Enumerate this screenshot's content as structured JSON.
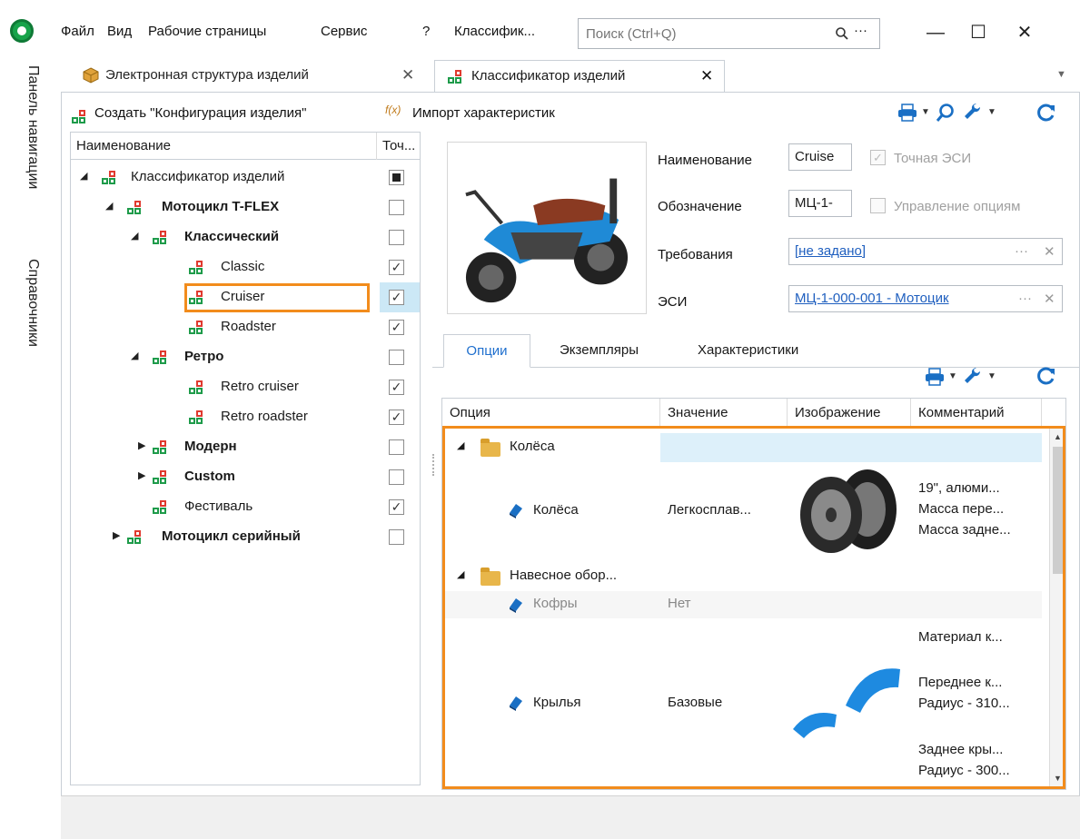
{
  "menu": [
    "Файл",
    "Вид",
    "Рабочие страницы",
    "Сервис",
    "?",
    "Классифик..."
  ],
  "search": {
    "placeholder": "Поиск (Ctrl+Q)"
  },
  "window_buttons": {
    "minimize": "—",
    "maximize": "☐",
    "close": "✕"
  },
  "nav": {
    "panel": "Панель навигации",
    "refs": "Справочники"
  },
  "tabs": [
    {
      "label": "Электронная структура изделий",
      "close": "✕"
    },
    {
      "label": "Классификатор изделий",
      "close": "✕"
    }
  ],
  "toolbar": {
    "create": "Создать \"Конфигурация изделия\"",
    "import": "Импорт характеристик"
  },
  "tree": {
    "headers": [
      "Наименование",
      "Точ..."
    ],
    "rows": [
      {
        "label": "Классификатор изделий",
        "expander": "◢",
        "check": "filled"
      },
      {
        "label": "Мотоцикл T-FLEX",
        "expander": "◢",
        "check": ""
      },
      {
        "label": "Классический",
        "expander": "◢",
        "check": ""
      },
      {
        "label": "Classic",
        "expander": "",
        "check": "✓"
      },
      {
        "label": "Cruiser",
        "expander": "",
        "check": "✓"
      },
      {
        "label": "Roadster",
        "expander": "",
        "check": "✓"
      },
      {
        "label": "Ретро",
        "expander": "◢",
        "check": ""
      },
      {
        "label": "Retro cruiser",
        "expander": "",
        "check": "✓"
      },
      {
        "label": "Retro roadster",
        "expander": "",
        "check": "✓"
      },
      {
        "label": "Модерн",
        "expander": "▶",
        "check": ""
      },
      {
        "label": "Custom",
        "expander": "▶",
        "check": ""
      },
      {
        "label": "Фестиваль",
        "expander": "",
        "check": "✓"
      },
      {
        "label": "Мотоцикл серийный",
        "expander": "▶",
        "check": ""
      }
    ]
  },
  "props": {
    "name_label": "Наименование",
    "name_value": "Cruise",
    "exact_label": "Точная ЭСИ",
    "code_label": "Обозначение",
    "code_value": "МЦ-1-",
    "options_mgmt_label": "Управление опциям",
    "req_label": "Требования",
    "req_value": "[не задано]",
    "esi_label": "ЭСИ",
    "esi_value": "МЦ-1-000-001 - Мотоцик",
    "ellipsis": "···",
    "clear": "✕"
  },
  "inner_tabs": [
    "Опции",
    "Экземпляры",
    "Характеристики"
  ],
  "options": {
    "headers": [
      "Опция",
      "Значение",
      "Изображение",
      "Комментарий"
    ],
    "groups": [
      {
        "name": "Колёса"
      },
      {
        "name": "Навесное обор..."
      }
    ],
    "items": [
      {
        "name": "Колёса",
        "value": "Легкосплав...",
        "comment": [
          "19\", алюми...",
          "Масса пере...",
          "Масса задне..."
        ]
      },
      {
        "name": "Кофры",
        "value": "Нет"
      },
      {
        "name": "Крылья",
        "value": "Базовые",
        "comment": [
          "Материал к...",
          "Переднее к...",
          "Радиус - 310...",
          "Заднее кры...",
          "Радиус - 300..."
        ]
      }
    ]
  },
  "colors": {
    "accent": "#f28c1c",
    "selection": "#cce8f6",
    "link": "#1f5fbf"
  }
}
